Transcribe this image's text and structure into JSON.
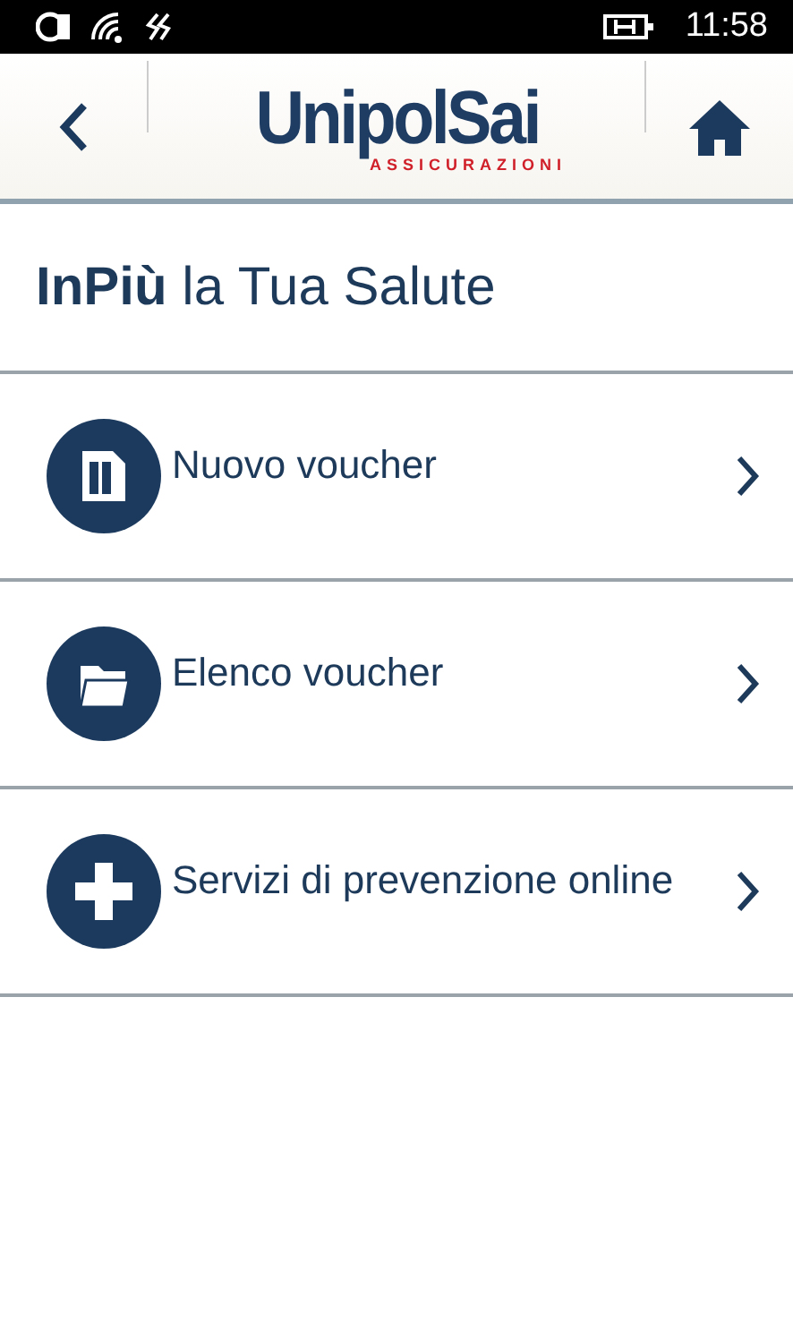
{
  "status_bar": {
    "time": "11:58"
  },
  "header": {
    "logo": {
      "name": "UnipolSai",
      "tagline": "ASSICURAZIONI"
    }
  },
  "page_title": "**InPiù** la Tua Salute",
  "menu": [
    {
      "label": "Nuovo voucher",
      "kind": "document"
    },
    {
      "label": "Elenco voucher",
      "kind": "folder"
    },
    {
      "label": "Servizi di prevenzione online",
      "kind": "plus"
    }
  ]
}
